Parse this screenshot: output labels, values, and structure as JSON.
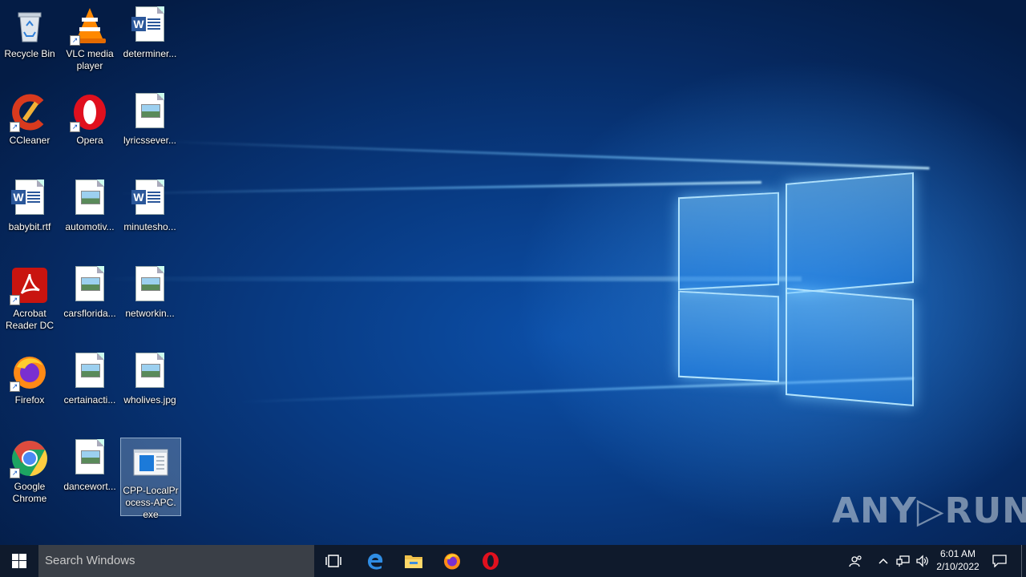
{
  "desktop": {
    "icons": [
      {
        "label": "Recycle Bin",
        "icon": "recycle-bin-icon",
        "shortcut": false
      },
      {
        "label": "VLC media player",
        "icon": "vlc-icon",
        "shortcut": true
      },
      {
        "label": "determiner...",
        "icon": "word-doc-icon",
        "shortcut": false
      },
      {
        "label": "CCleaner",
        "icon": "ccleaner-icon",
        "shortcut": true
      },
      {
        "label": "Opera",
        "icon": "opera-icon",
        "shortcut": true
      },
      {
        "label": "lyricssever...",
        "icon": "image-file-icon",
        "shortcut": false
      },
      {
        "label": "babybit.rtf",
        "icon": "word-doc-icon",
        "shortcut": false
      },
      {
        "label": "automotiv...",
        "icon": "image-file-icon",
        "shortcut": false
      },
      {
        "label": "minutesho...",
        "icon": "word-doc-icon",
        "shortcut": false
      },
      {
        "label": "Acrobat Reader DC",
        "icon": "acrobat-icon",
        "shortcut": true
      },
      {
        "label": "carsflorida...",
        "icon": "image-file-icon",
        "shortcut": false
      },
      {
        "label": "networkin...",
        "icon": "image-file-icon",
        "shortcut": false
      },
      {
        "label": "Firefox",
        "icon": "firefox-icon",
        "shortcut": true
      },
      {
        "label": "certainacti...",
        "icon": "image-file-icon",
        "shortcut": false
      },
      {
        "label": "wholives.jpg",
        "icon": "image-file-icon",
        "shortcut": false
      },
      {
        "label": "Google Chrome",
        "icon": "chrome-icon",
        "shortcut": true
      },
      {
        "label": "dancewort...",
        "icon": "image-file-icon",
        "shortcut": false
      },
      {
        "label": "CPP-LocalProcess-APC.exe",
        "icon": "exe-window-icon",
        "shortcut": false,
        "selected": true
      }
    ]
  },
  "taskbar": {
    "search_placeholder": "Search Windows",
    "pinned": [
      "task-view-icon",
      "edge-icon",
      "file-explorer-icon",
      "firefox-icon",
      "opera-icon"
    ],
    "clock_time": "6:01 AM",
    "clock_date": "2/10/2022"
  },
  "watermark": "ANY▷RUN",
  "colors": {
    "taskbar_bg": "#0f1a2c",
    "search_bg": "#3a3f47",
    "accent_blue": "#0c4fa8"
  }
}
